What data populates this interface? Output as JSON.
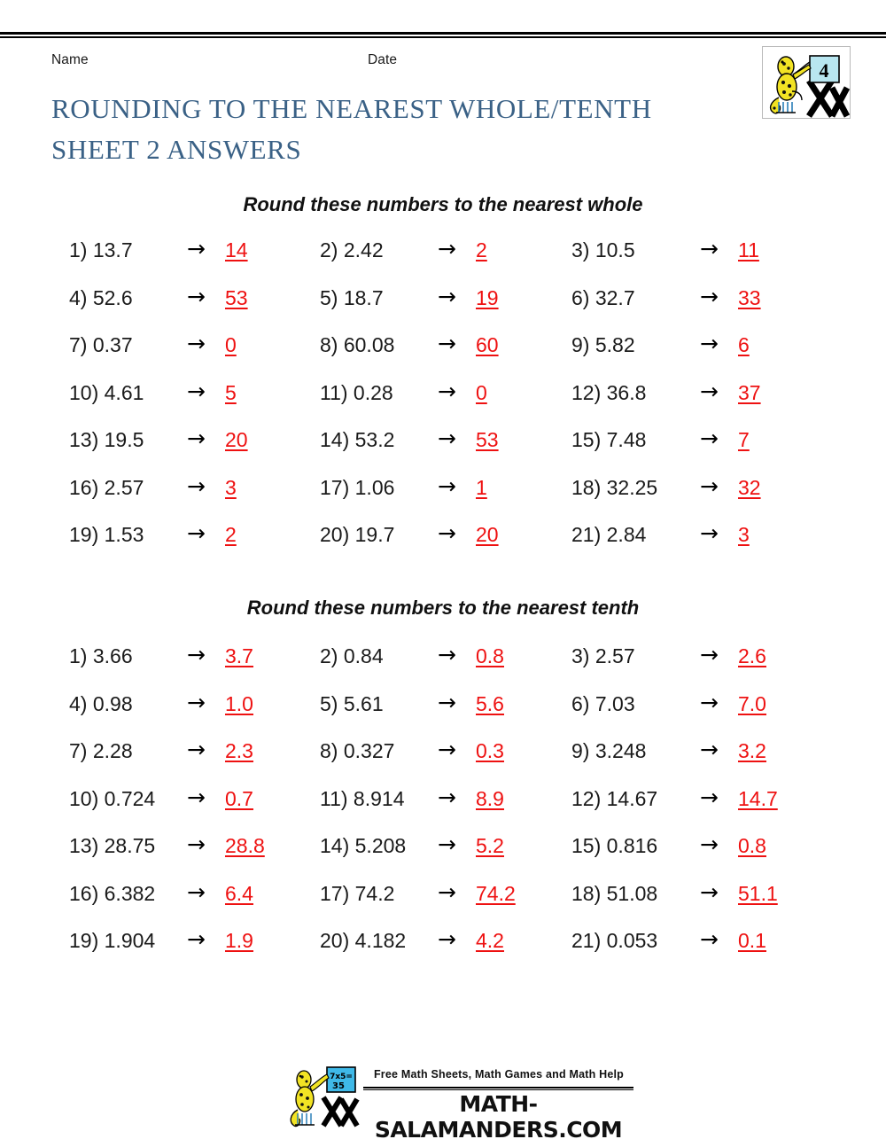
{
  "page": {
    "name_label": "Name",
    "date_label": "Date",
    "title_line1": "ROUNDING TO THE NEAREST WHOLE/TENTH",
    "title_line2": "SHEET 2 ANSWERS",
    "title_color": "#3a6186",
    "answer_color": "#ee1111",
    "badge_number": "4"
  },
  "sections": [
    {
      "id": "whole",
      "heading": "Round these numbers to the nearest whole",
      "rows": [
        [
          {
            "num": "1)",
            "value": "13.7",
            "arrow": "→",
            "answer": "14"
          },
          {
            "num": "2)",
            "value": "2.42",
            "arrow": "→",
            "answer": "2"
          },
          {
            "num": "3)",
            "value": "10.5",
            "arrow": "→",
            "answer": "11"
          }
        ],
        [
          {
            "num": "4)",
            "value": "52.6",
            "arrow": "→",
            "answer": "53"
          },
          {
            "num": "5)",
            "value": "18.7",
            "arrow": "→",
            "answer": "19"
          },
          {
            "num": "6)",
            "value": "32.7",
            "arrow": "→",
            "answer": "33"
          }
        ],
        [
          {
            "num": "7)",
            "value": "0.37",
            "arrow": "→",
            "answer": "0"
          },
          {
            "num": "8)",
            "value": "60.08",
            "arrow": "→",
            "answer": "60"
          },
          {
            "num": "9)",
            "value": "5.82",
            "arrow": "→",
            "answer": "6"
          }
        ],
        [
          {
            "num": "10)",
            "value": "4.61",
            "arrow": "→",
            "answer": "5"
          },
          {
            "num": "11)",
            "value": "0.28",
            "arrow": "→",
            "answer": "0"
          },
          {
            "num": "12)",
            "value": "36.8",
            "arrow": "→",
            "answer": "37"
          }
        ],
        [
          {
            "num": "13)",
            "value": "19.5",
            "arrow": "→",
            "answer": "20"
          },
          {
            "num": "14)",
            "value": "53.2",
            "arrow": "→",
            "answer": "53"
          },
          {
            "num": "15)",
            "value": "7.48",
            "arrow": "→",
            "answer": "7"
          }
        ],
        [
          {
            "num": "16)",
            "value": "2.57",
            "arrow": "→",
            "answer": "3"
          },
          {
            "num": "17)",
            "value": "1.06",
            "arrow": "→",
            "answer": "1"
          },
          {
            "num": "18)",
            "value": "32.25",
            "arrow": "→",
            "answer": "32"
          }
        ],
        [
          {
            "num": "19)",
            "value": "1.53",
            "arrow": "→",
            "answer": "2"
          },
          {
            "num": "20)",
            "value": "19.7",
            "arrow": "→",
            "answer": "20"
          },
          {
            "num": "21)",
            "value": "2.84",
            "arrow": "→",
            "answer": "3"
          }
        ]
      ]
    },
    {
      "id": "tenth",
      "heading": "Round these numbers to the nearest tenth",
      "rows": [
        [
          {
            "num": "1)",
            "value": "3.66",
            "arrow": "→",
            "answer": "3.7"
          },
          {
            "num": "2)",
            "value": "0.84",
            "arrow": "→",
            "answer": "0.8"
          },
          {
            "num": "3)",
            "value": "2.57",
            "arrow": "→",
            "answer": "2.6"
          }
        ],
        [
          {
            "num": "4)",
            "value": "0.98",
            "arrow": "→",
            "answer": "1.0"
          },
          {
            "num": "5)",
            "value": "5.61",
            "arrow": "→",
            "answer": "5.6"
          },
          {
            "num": "6)",
            "value": "7.03",
            "arrow": "→",
            "answer": "7.0"
          }
        ],
        [
          {
            "num": "7)",
            "value": "2.28",
            "arrow": "→",
            "answer": "2.3"
          },
          {
            "num": "8)",
            "value": "0.327",
            "arrow": "→",
            "answer": "0.3"
          },
          {
            "num": "9)",
            "value": "3.248",
            "arrow": "→",
            "answer": "3.2"
          }
        ],
        [
          {
            "num": "10)",
            "value": "0.724",
            "arrow": "→",
            "answer": "0.7"
          },
          {
            "num": "11)",
            "value": "8.914",
            "arrow": "→",
            "answer": "8.9"
          },
          {
            "num": "12)",
            "value": "14.67",
            "arrow": "→",
            "answer": "14.7"
          }
        ],
        [
          {
            "num": "13)",
            "value": "28.75",
            "arrow": "→",
            "answer": "28.8"
          },
          {
            "num": "14)",
            "value": "5.208",
            "arrow": "→",
            "answer": "5.2"
          },
          {
            "num": "15)",
            "value": "0.816",
            "arrow": "→",
            "answer": "0.8"
          }
        ],
        [
          {
            "num": "16)",
            "value": "6.382",
            "arrow": "→",
            "answer": "6.4"
          },
          {
            "num": "17)",
            "value": "74.2",
            "arrow": "→",
            "answer": "74.2"
          },
          {
            "num": "18)",
            "value": "51.08",
            "arrow": "→",
            "answer": "51.1"
          }
        ],
        [
          {
            "num": "19)",
            "value": "1.904",
            "arrow": "→",
            "answer": "1.9"
          },
          {
            "num": "20)",
            "value": "4.182",
            "arrow": "→",
            "answer": "4.2"
          },
          {
            "num": "21)",
            "value": "0.053",
            "arrow": "→",
            "answer": "0.1"
          }
        ]
      ]
    }
  ],
  "footer": {
    "tagline": "Free Math Sheets, Math Games and Math Help",
    "domain": "MATH-SALAMANDERS.COM",
    "board_text_line1": "7x5=",
    "board_text_line2": "35"
  }
}
